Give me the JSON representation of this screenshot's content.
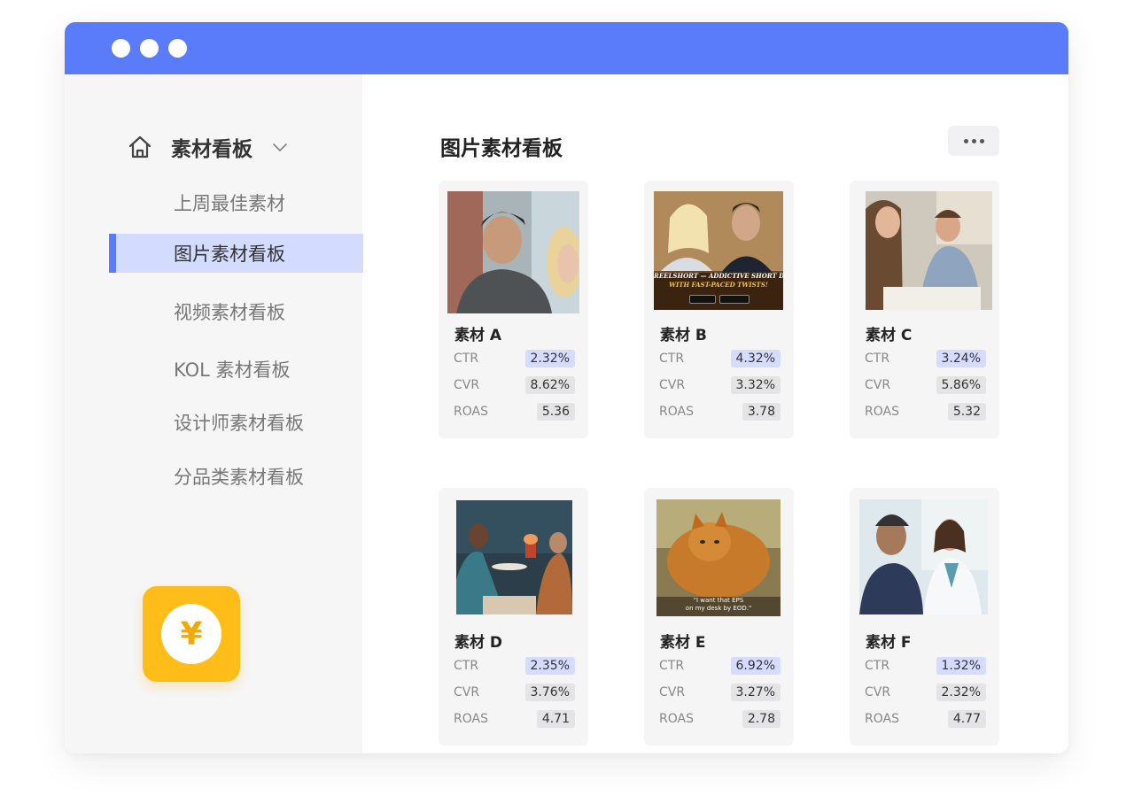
{
  "sidebar": {
    "header_label": "素材看板",
    "items": [
      {
        "label": "上周最佳素材",
        "active": false
      },
      {
        "label": "图片素材看板",
        "active": true
      },
      {
        "label": "视频素材看板",
        "active": false
      },
      {
        "label": "KOL 素材看板",
        "active": false
      },
      {
        "label": "设计师素材看板",
        "active": false
      },
      {
        "label": "分品类素材看板",
        "active": false
      }
    ],
    "app_icon_symbol": "¥"
  },
  "main": {
    "title": "图片素材看板",
    "cards": [
      {
        "title": "素材 A",
        "ctr": "2.32%",
        "cvr": "8.62%",
        "roas": "5.36"
      },
      {
        "title": "素材 B",
        "ctr": "4.32%",
        "cvr": "3.32%",
        "roas": "3.78",
        "banner": "REELSHORT — ADDICTIVE SHORT DRAMAS",
        "banner2": "WITH FAST-PACED TWISTS!"
      },
      {
        "title": "素材 C",
        "ctr": "3.24%",
        "cvr": "5.86%",
        "roas": "5.32"
      },
      {
        "title": "素材 D",
        "ctr": "2.35%",
        "cvr": "3.76%",
        "roas": "4.71"
      },
      {
        "title": "素材 E",
        "ctr": "6.92%",
        "cvr": "3.27%",
        "roas": "2.78",
        "caption": "\"I want that EPS",
        "caption2": "on my desk by EOD.\""
      },
      {
        "title": "素材 F",
        "ctr": "1.32%",
        "cvr": "2.32%",
        "roas": "4.77"
      }
    ],
    "metric_labels": {
      "ctr": "CTR",
      "cvr": "CVR",
      "roas": "ROAS"
    }
  },
  "colors": {
    "accent": "#5b7cfa",
    "active_bg": "#d3dcff",
    "highlight": "#d6dcff",
    "coin": "#ffbd1a"
  }
}
